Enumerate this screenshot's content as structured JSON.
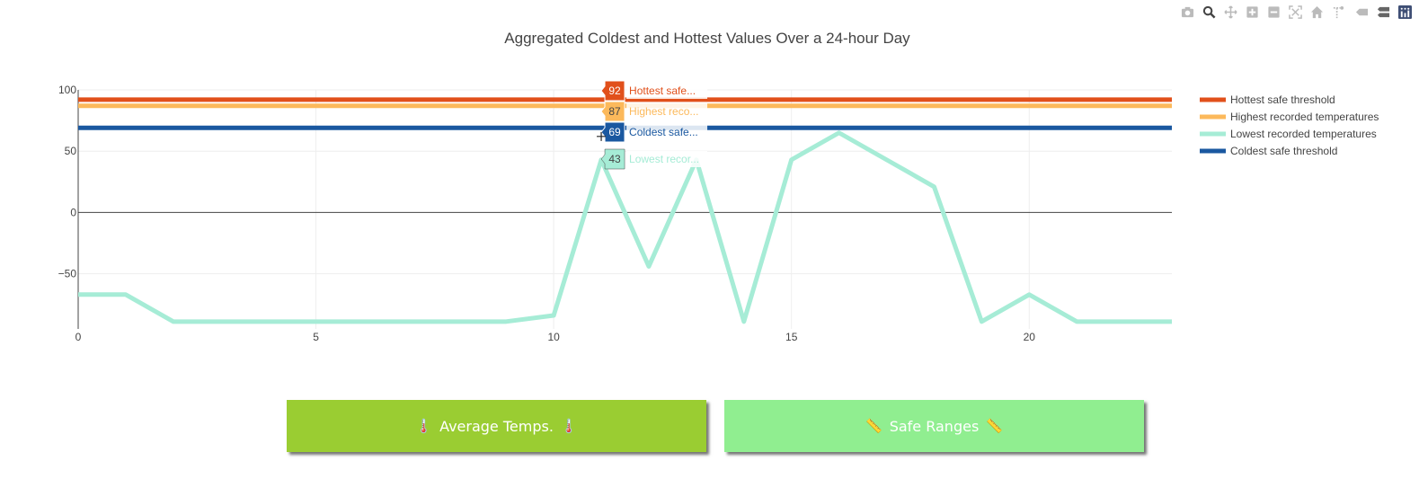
{
  "modebar": {
    "icons": [
      "camera-icon",
      "zoom-icon",
      "pan-icon",
      "zoom-in-icon",
      "zoom-out-icon",
      "autoscale-icon",
      "home-icon",
      "spike-lines-icon",
      "hover-closest-icon",
      "hover-compare-icon",
      "plotly-logo-icon"
    ],
    "active_color": "#444444",
    "inactive_color": "#bbbbbb"
  },
  "chart_data": {
    "type": "line",
    "title": "Aggregated Coldest and Hottest Values Over a 24-hour Day",
    "xlabel": "",
    "ylabel": "",
    "xlim": [
      0,
      23
    ],
    "ylim": [
      -95,
      100
    ],
    "x_ticks": [
      0,
      5,
      10,
      15,
      20
    ],
    "y_ticks": [
      -50,
      0,
      50,
      100
    ],
    "y_tick_labels": [
      "−50",
      "0",
      "50",
      "100"
    ],
    "grid": true,
    "legend_position": "top-right",
    "x": [
      0,
      1,
      2,
      3,
      4,
      5,
      6,
      7,
      8,
      9,
      10,
      11,
      12,
      13,
      14,
      15,
      16,
      17,
      18,
      19,
      20,
      21,
      22,
      23
    ],
    "series": [
      {
        "name": "Hottest safe threshold",
        "color": "#e1501b",
        "values": [
          92,
          92,
          92,
          92,
          92,
          92,
          92,
          92,
          92,
          92,
          92,
          92,
          92,
          92,
          92,
          92,
          92,
          92,
          92,
          92,
          92,
          92,
          92,
          92
        ]
      },
      {
        "name": "Highest recorded temperatures",
        "color": "#fcb95b",
        "values": [
          87,
          87,
          87,
          87,
          87,
          87,
          87,
          87,
          87,
          87,
          87,
          87,
          87,
          87,
          87,
          87,
          87,
          87,
          87,
          87,
          87,
          87,
          87,
          87
        ]
      },
      {
        "name": "Lowest recorded temperatures",
        "color": "#a6ecd6",
        "values": [
          -67,
          -67,
          -89,
          -89,
          -89,
          -89,
          -89,
          -89,
          -89,
          -89,
          -84,
          43,
          -44,
          43,
          -89,
          43,
          65,
          43,
          21,
          -89,
          -67,
          -89,
          -89,
          -89
        ]
      },
      {
        "name": "Coldest safe threshold",
        "color": "#1a58a0",
        "values": [
          69,
          69,
          69,
          69,
          69,
          69,
          69,
          69,
          69,
          69,
          69,
          69,
          69,
          69,
          69,
          69,
          69,
          69,
          69,
          69,
          69,
          69,
          69,
          69
        ]
      }
    ],
    "legend_order": [
      0,
      1,
      2,
      3
    ],
    "hover": {
      "x": 11,
      "labels": [
        {
          "value": "92",
          "text": "Hottest safe...",
          "series": 0,
          "text_color": "#e1501b",
          "value_color": "#ffffff"
        },
        {
          "value": "87",
          "text": "Highest reco...",
          "series": 1,
          "text_color": "#fcb95b",
          "value_color": "#444444"
        },
        {
          "value": "69",
          "text": "Coldest safe...",
          "series": 3,
          "text_color": "#1a58a0",
          "value_color": "#ffffff"
        },
        {
          "value": "43",
          "text": "Lowest recor...",
          "series": 2,
          "text_color": "#a6ecd6",
          "value_color": "#444444"
        }
      ]
    }
  },
  "buttons": {
    "average": {
      "label": "Average Temps.",
      "icon": "🌡️"
    },
    "safe": {
      "label": "Safe Ranges",
      "icon": "📏"
    }
  }
}
